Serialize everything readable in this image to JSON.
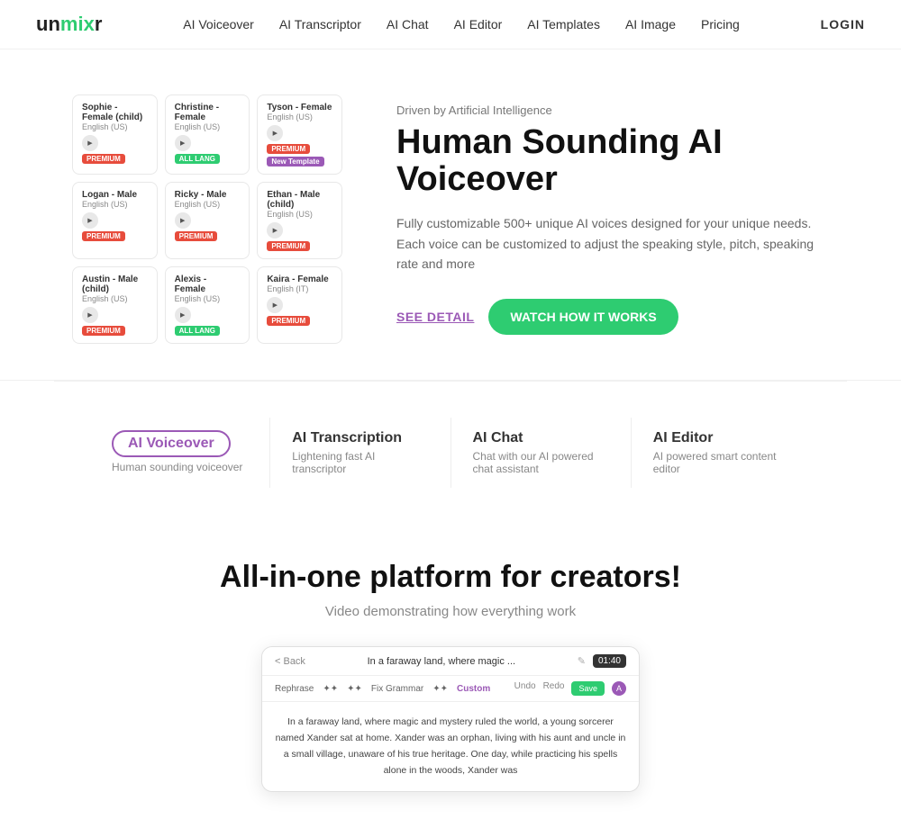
{
  "logo": {
    "text_before": "un",
    "text_highlight": "mix",
    "text_after": "r"
  },
  "nav": {
    "links": [
      {
        "label": "AI Voiceover",
        "id": "ai-voiceover"
      },
      {
        "label": "AI Transcriptor",
        "id": "ai-transcriptor"
      },
      {
        "label": "AI Chat",
        "id": "ai-chat"
      },
      {
        "label": "AI Editor",
        "id": "ai-editor"
      },
      {
        "label": "AI Templates",
        "id": "ai-templates"
      },
      {
        "label": "AI Image",
        "id": "ai-image"
      },
      {
        "label": "Pricing",
        "id": "pricing"
      }
    ],
    "login_label": "LOGIN"
  },
  "hero": {
    "subtitle": "Driven by Artificial Intelligence",
    "title": "Human Sounding AI Voiceover",
    "description": "Fully customizable 500+ unique AI voices designed for your unique needs. Each voice can be customized to adjust the speaking style, pitch, speaking rate and more",
    "btn_detail": "SEE DETAIL",
    "btn_watch": "WATCH HOW IT WORKS",
    "voices": [
      {
        "name": "Sophie",
        "gender": "Female (child)",
        "lang": "English (US)",
        "badge": "premium",
        "badge_label": "PREMIUM"
      },
      {
        "name": "Christine",
        "gender": "Female",
        "lang": "English (US)",
        "badge": "free",
        "badge_label": "ALL LANG"
      },
      {
        "name": "Tyson",
        "gender": "Female",
        "lang": "English (US)",
        "badge": "premium",
        "badge_label": "PREMIUM",
        "extra_badge": "natural",
        "extra_label": "New Template"
      },
      {
        "name": "Logan",
        "gender": "Male",
        "lang": "English (US)",
        "badge": "premium",
        "badge_label": "PREMIUM"
      },
      {
        "name": "Ricky",
        "gender": "Male",
        "lang": "English (US)",
        "badge": "premium",
        "badge_label": "PREMIUM"
      },
      {
        "name": "Ethan",
        "gender": "Male (child)",
        "lang": "English (US)",
        "badge": "premium",
        "badge_label": "PREMIUM"
      },
      {
        "name": "Austin",
        "gender": "Male (child)",
        "lang": "English (US)",
        "badge": "premium",
        "badge_label": "PREMIUM"
      },
      {
        "name": "Alexis",
        "gender": "Female",
        "lang": "English (US)",
        "badge": "free",
        "badge_label": "ALL LANG"
      },
      {
        "name": "Kaira",
        "gender": "Female",
        "lang": "English (IT)",
        "badge": "premium",
        "badge_label": "PREMIUM"
      }
    ]
  },
  "tabs": [
    {
      "label": "AI Voiceover",
      "desc": "Human sounding voiceover",
      "active": true
    },
    {
      "label": "AI Transcription",
      "desc": "Lightening fast AI transcriptor",
      "active": false
    },
    {
      "label": "AI Chat",
      "desc": "Chat with our AI powered chat assistant",
      "active": false
    },
    {
      "label": "AI Editor",
      "desc": "AI powered smart content editor",
      "active": false
    }
  ],
  "allinone": {
    "title": "All-in-one platform for creators!",
    "subtitle": "Video demonstrating how everything work"
  },
  "video_preview": {
    "back_label": "< Back",
    "title": "In a faraway land, where magic ...",
    "timer": "01:40",
    "toolbar_items": [
      "Rephrase",
      "✦✦",
      "✦✦",
      "Fix Grammar",
      "✦✦",
      "Custom"
    ],
    "undo_label": "Undo",
    "redo_label": "Redo",
    "save_label": "Save",
    "content": "In a faraway land, where magic and mystery ruled the world, a young sorcerer named Xander sat at home. Xander was an orphan, living with his aunt and uncle in a small village, unaware of his true heritage. One day, while practicing his spells alone in the woods, Xander was"
  }
}
